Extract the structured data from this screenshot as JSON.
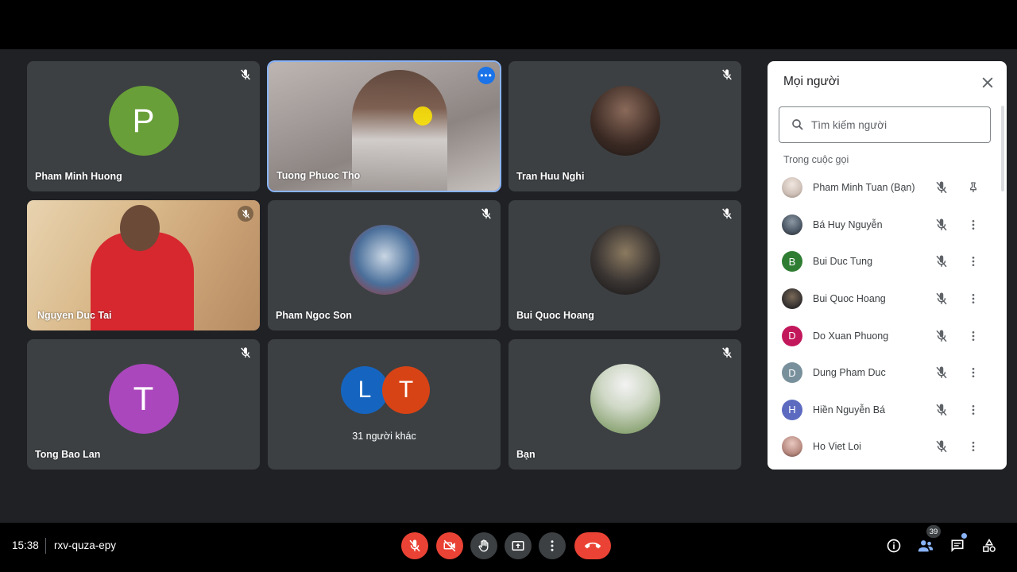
{
  "tiles": [
    {
      "name": "Pham Minh Huong",
      "initial": "P",
      "color": "#689f38"
    },
    {
      "name": "Tuong Phuoc Tho"
    },
    {
      "name": "Tran Huu Nghi"
    },
    {
      "name": "Nguyen Duc Tai"
    },
    {
      "name": "Pham Ngoc Son"
    },
    {
      "name": "Bui Quoc Hoang"
    },
    {
      "name": "Tong Bao Lan",
      "initial": "T",
      "color": "#ab47bc"
    },
    {
      "others_label": "31 người khác",
      "initials": [
        "L",
        "T"
      ],
      "colors": [
        "#1565c0",
        "#d84315"
      ]
    },
    {
      "name": "Bạn"
    }
  ],
  "panel": {
    "title": "Mọi người",
    "search_placeholder": "Tìm kiếm người",
    "section": "Trong cuộc gọi",
    "people": [
      {
        "name": "Pham Minh Tuan (Bạn)",
        "avatar": "photo",
        "action": "pin-icon"
      },
      {
        "name": "Bá Huy Nguyễn",
        "avatar": "photo",
        "action": "more-vert-icon"
      },
      {
        "name": "Bui Duc Tung",
        "initial": "B",
        "color": "#2e7d32",
        "action": "more-vert-icon"
      },
      {
        "name": "Bui Quoc Hoang",
        "avatar": "photo",
        "action": "more-vert-icon"
      },
      {
        "name": "Do Xuan Phuong",
        "initial": "D",
        "color": "#c2185b",
        "action": "more-vert-icon"
      },
      {
        "name": "Dung Pham Duc",
        "initial": "D",
        "color": "#78909c",
        "action": "more-vert-icon"
      },
      {
        "name": "Hiền Nguyễn Bá",
        "initial": "H",
        "color": "#5c6bc0",
        "action": "more-vert-icon"
      },
      {
        "name": "Ho Viet Loi",
        "avatar": "photo",
        "action": "more-vert-icon"
      }
    ]
  },
  "bottom": {
    "time": "15:38",
    "meeting_code": "rxv-quza-epy",
    "participants_count": "39"
  }
}
